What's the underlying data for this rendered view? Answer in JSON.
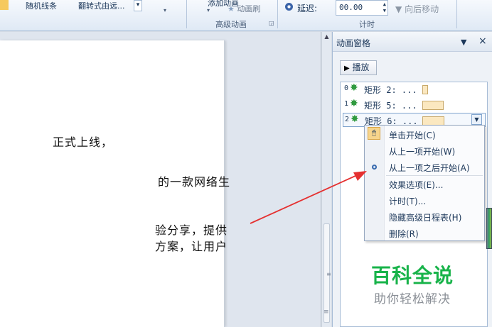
{
  "ribbon": {
    "gallery_items": [
      "随机线条",
      "翻转式由远..."
    ],
    "clipped_labels": [
      "添加动画"
    ],
    "animation_painter": "动画刷",
    "advanced_group_label": "高级动画",
    "delay_label": "延迟:",
    "delay_value": "00.00",
    "move_later": "向后移动",
    "timing_group_label": "计时"
  },
  "document": {
    "lines": [
      "正式上线，",
      "的一款网络生",
      "验分享，提供",
      "方案，让用户"
    ]
  },
  "pane": {
    "title": "动画窗格",
    "play_label": "播放",
    "items": [
      {
        "num": "0",
        "label": "矩形 2: ..."
      },
      {
        "num": "1",
        "label": "矩形 5: ..."
      },
      {
        "num": "2",
        "label": "矩形 6: ..."
      }
    ]
  },
  "context_menu": {
    "items": [
      "单击开始(C)",
      "从上一项开始(W)",
      "从上一项之后开始(A)",
      "效果选项(E)...",
      "计时(T)...",
      "隐藏高级日程表(H)",
      "删除(R)"
    ],
    "checked_item": "从上一项之后开始(A)"
  },
  "watermark": {
    "title": "百科全说",
    "subtitle": "助你轻松解决"
  },
  "icons": {
    "play": "play-icon",
    "star": "green-star-effect-icon",
    "delay": "clock-icon",
    "close": "close-icon"
  },
  "colors": {
    "accent_arrow": "#e53030",
    "watermark_green": "#18b34a",
    "timing_bar": "#fbe8c0"
  }
}
